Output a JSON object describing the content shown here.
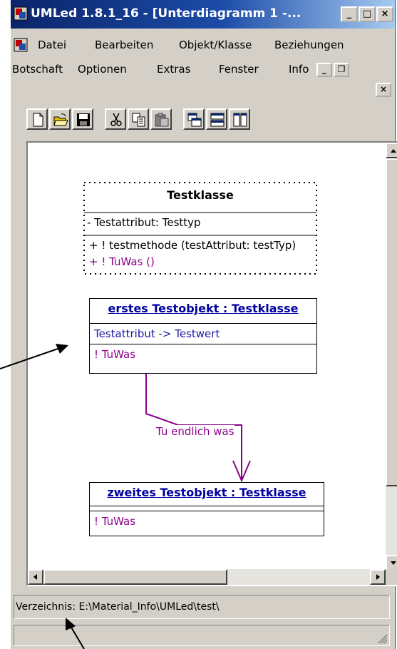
{
  "window": {
    "title": "UMLed 1.8.1_16 - [Unterdiagramm 1 -...",
    "controls": [
      "_",
      "□",
      "×"
    ]
  },
  "menu": {
    "row1": [
      "Datei",
      "Bearbeiten",
      "Objekt/Klasse",
      "Beziehungen"
    ],
    "row2": [
      "Botschaft",
      "Optionen",
      "Extras",
      "Fenster",
      "Info"
    ],
    "mdi_controls": [
      "_",
      "❐",
      "×"
    ]
  },
  "toolbar": {
    "buttons": [
      "new-icon",
      "open-icon",
      "save-icon",
      "cut-icon",
      "copy-icon",
      "paste-icon",
      "cascade-icon",
      "tile-horizontal-icon",
      "tile-vertical-icon"
    ]
  },
  "diagram": {
    "class": {
      "name": "Testklasse",
      "attribute": "- Testattribut: Testtyp",
      "method1": "+ ! testmethode (testAttribut: testTyp)",
      "method2": "+ ! TuWas ()"
    },
    "object1": {
      "name": "erstes Testobjekt : Testklasse",
      "attribute": "Testattribut -> Testwert",
      "message": "! TuWas"
    },
    "object2": {
      "name": "zweites Testobjekt : Testklasse",
      "message": "! TuWas"
    },
    "link_label": "Tu endlich was"
  },
  "statusbar": {
    "directory": "Verzeichnis: E:\\Material_Info\\UMLed\\test\\"
  },
  "colors": {
    "title_bar": "#0a246a",
    "face": "#d4d0c8",
    "message": "#8b008b",
    "object_name": "#0000a0"
  }
}
